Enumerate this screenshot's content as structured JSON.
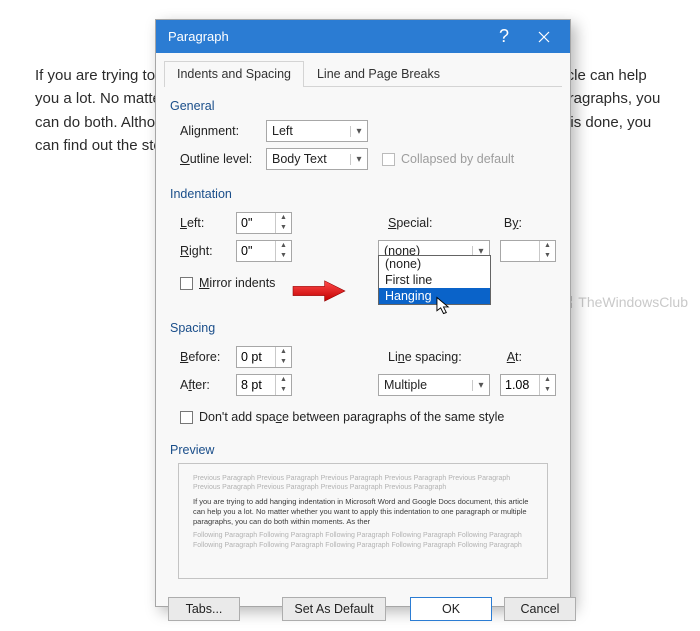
{
  "bg_paragraph": "If you are trying to add hanging indentation in Microsoft Word document, this article can help you a lot. No matter whether you want to apply it to one paragraph or multiple paragraphs, you can do both. Although there is no one-click button available in both tools to get this done, you can find out the steps here.",
  "watermark": "TheWindowsClub",
  "dialog": {
    "title": "Paragraph",
    "tabs": {
      "t1": "Indents and Spacing",
      "t2": "Line and Page Breaks"
    },
    "general": {
      "header": "General",
      "alignment_label": "Alignment:",
      "alignment_value": "Left",
      "outline_label": "Outline level:",
      "outline_value": "Body Text",
      "collapsed_label": "Collapsed by default"
    },
    "indent": {
      "header": "Indentation",
      "left_label": "Left:",
      "left_value": "0\"",
      "right_label": "Right:",
      "right_value": "0\"",
      "special_label": "Special:",
      "special_value": "(none)",
      "by_label": "By:",
      "by_value": "",
      "mirror_label": "Mirror indents",
      "options": {
        "o1": "(none)",
        "o2": "First line",
        "o3": "Hanging"
      }
    },
    "spacing": {
      "header": "Spacing",
      "before_label": "Before:",
      "before_value": "0 pt",
      "after_label": "After:",
      "after_value": "8 pt",
      "line_label": "Line spacing:",
      "line_value": "Multiple",
      "at_label": "At:",
      "at_value": "1.08",
      "dont_add_label": "Don't add space between paragraphs of the same style"
    },
    "preview": {
      "header": "Preview",
      "prev_para": "Previous Paragraph Previous Paragraph Previous Paragraph Previous Paragraph Previous Paragraph Previous Paragraph Previous Paragraph Previous Paragraph Previous Paragraph",
      "sample": "If you are trying to add hanging indentation in Microsoft Word and Google Docs document, this article can help you a lot. No matter whether you want to apply this indentation to one paragraph or multiple paragraphs, you can do both within moments. As ther",
      "next_para": "Following Paragraph Following Paragraph Following Paragraph Following Paragraph Following Paragraph Following Paragraph Following Paragraph Following Paragraph Following Paragraph Following Paragraph"
    },
    "buttons": {
      "tabs": "Tabs...",
      "default": "Set As Default",
      "ok": "OK",
      "cancel": "Cancel"
    }
  }
}
